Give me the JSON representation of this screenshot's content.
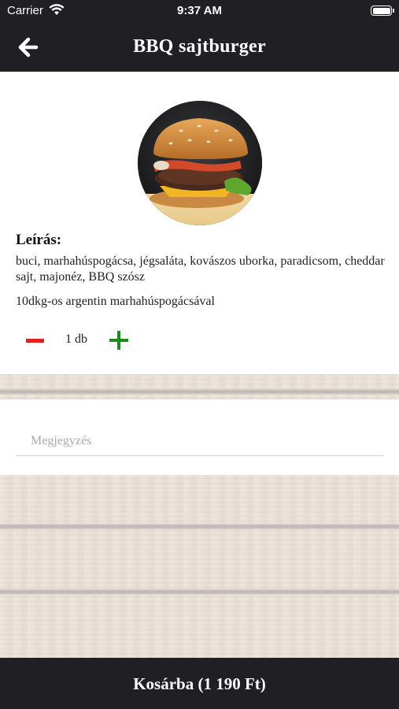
{
  "status_bar": {
    "carrier": "Carrier",
    "time": "9:37 AM"
  },
  "nav": {
    "title": "BBQ sajtburger",
    "back_icon": "arrow-left-icon"
  },
  "product": {
    "image_icon": "burger-image",
    "description_heading": "Leírás:",
    "description": "buci, marhahúspogácsa, jégsaláta, kovászos uborka, paradicsom, cheddar sajt, majonéz, BBQ szósz",
    "note": "10dkg-os argentin marhahúspogácsával",
    "quantity_label": "1 db",
    "quantity": 1
  },
  "note_field": {
    "placeholder": "Megjegyzés",
    "value": ""
  },
  "cart_button": {
    "label": "Kosárba (1 190 Ft)"
  },
  "colors": {
    "bar": "#201f24",
    "minus": "#e22020",
    "plus": "#1c8a1c"
  }
}
